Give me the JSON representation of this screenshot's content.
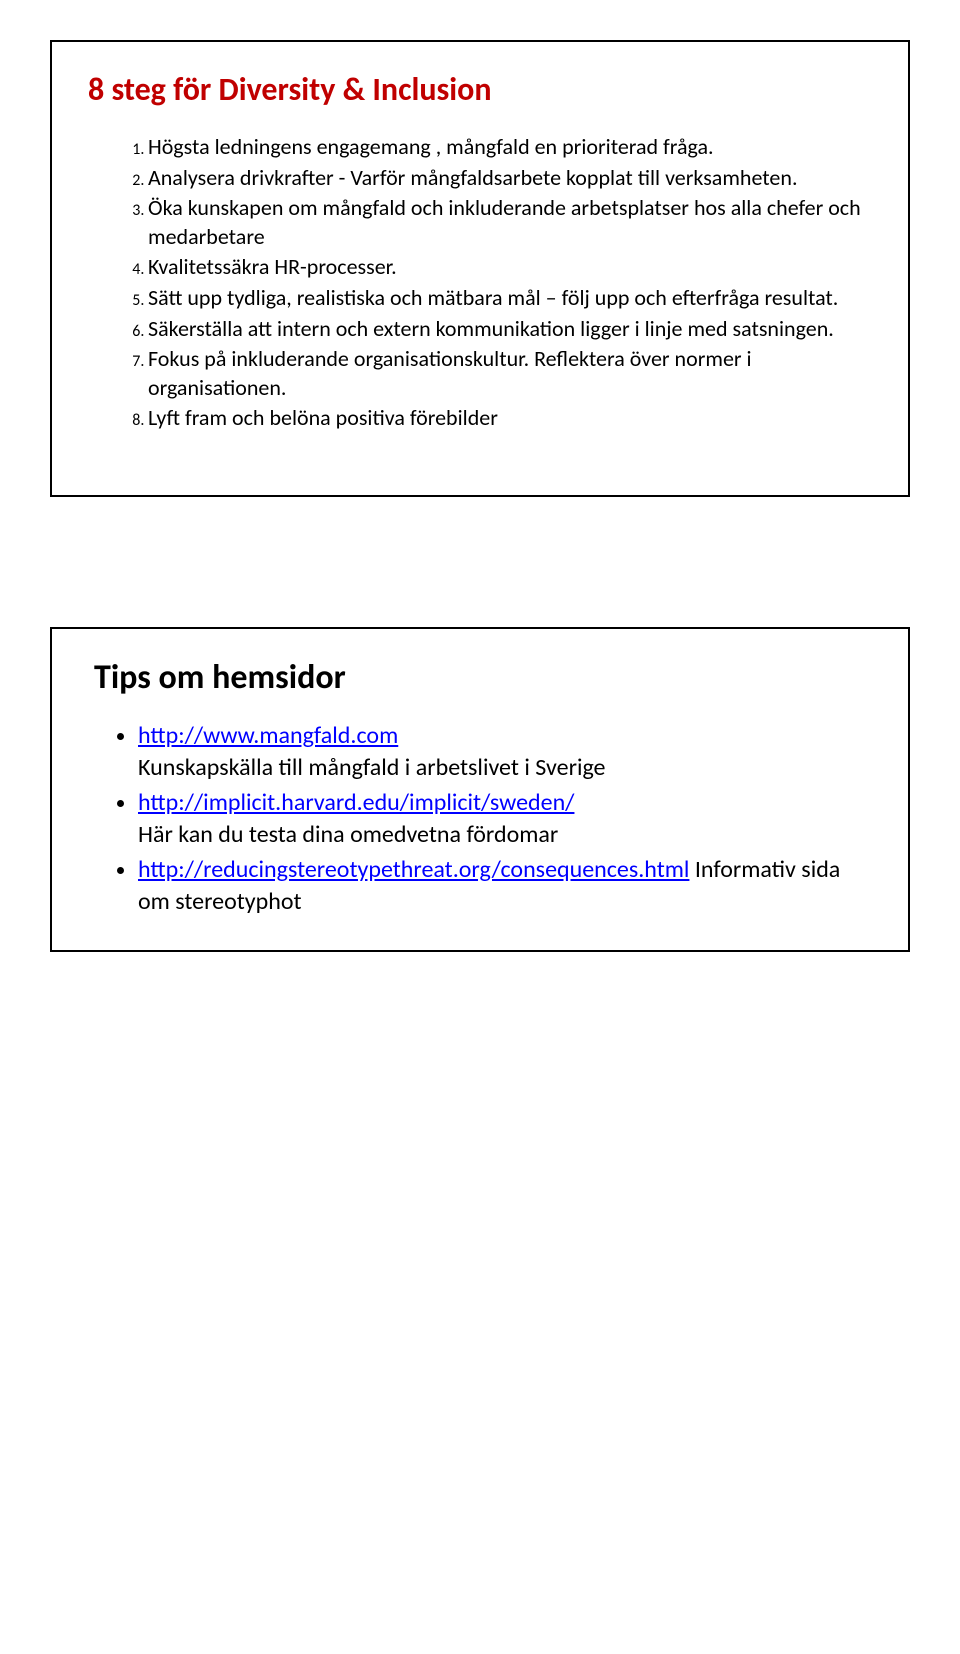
{
  "slide1": {
    "title": "8 steg för Diversity & Inclusion",
    "items": [
      "Högsta ledningens engagemang , mångfald en prioriterad fråga.",
      "Analysera drivkrafter - Varför mångfaldsarbete kopplat till verksamheten.",
      "Öka kunskapen om mångfald och inkluderande arbetsplatser hos alla chefer och medarbetare",
      "Kvalitetssäkra HR-processer.",
      "Sätt upp tydliga, realistiska och mätbara mål – följ upp och efterfråga resultat.",
      "Säkerställa att intern och extern kommunikation ligger i linje med satsningen.",
      "Fokus på inkluderande organisationskultur. Reflektera över normer i organisationen.",
      "Lyft fram och belöna positiva förebilder"
    ]
  },
  "slide2": {
    "title": "Tips om hemsidor",
    "items": [
      {
        "url": "http://www.mangfald.com",
        "text": "Kunskapskälla till mångfald i arbetslivet i Sverige"
      },
      {
        "url": "http://implicit.harvard.edu/implicit/sweden/",
        "text": "Här kan du testa dina omedvetna fördomar"
      },
      {
        "url": "http://reducingstereotypethreat.org/consequences.html",
        "url_suffix": " ",
        "text": "Informativ sida om stereotyphot"
      }
    ]
  }
}
